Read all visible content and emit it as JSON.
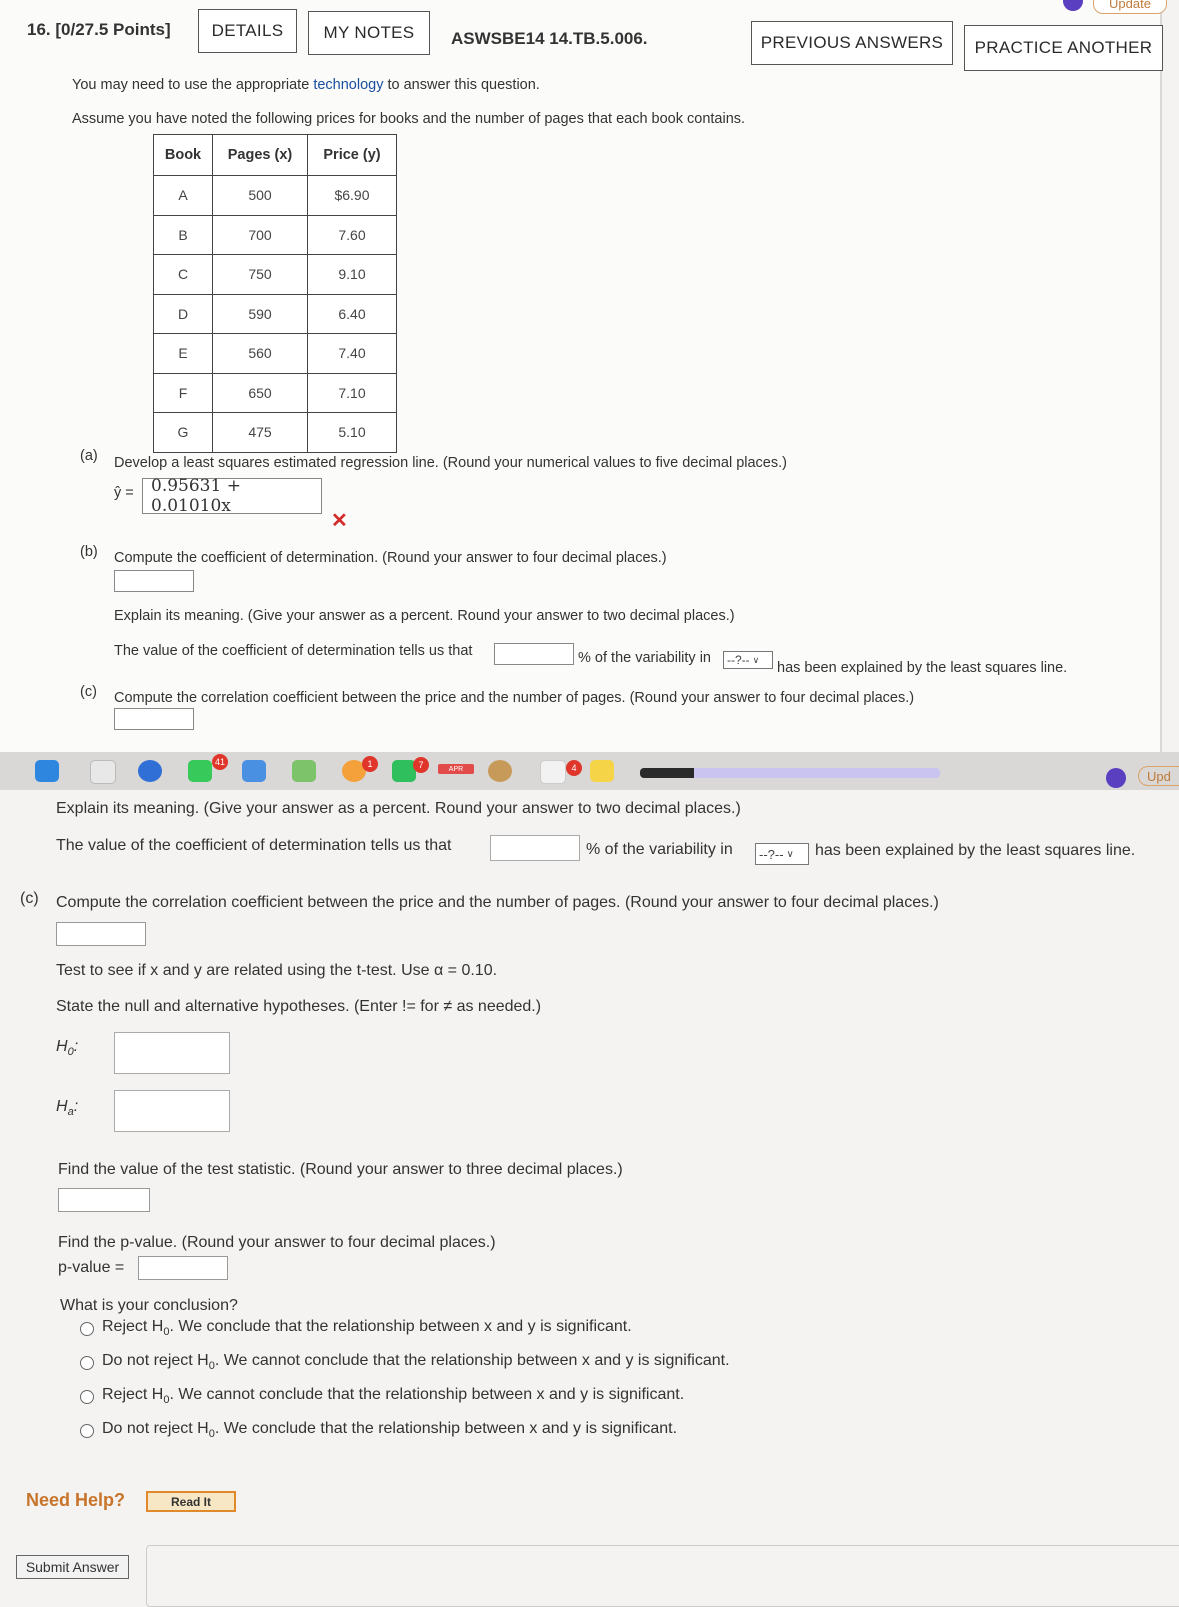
{
  "header": {
    "question_number": "16. [0/27.5 Points]",
    "details_label": "DETAILS",
    "my_notes_label": "MY NOTES",
    "question_code": "ASWSBE14 14.TB.5.006.",
    "previous_answers_label": "PREVIOUS ANSWERS",
    "practice_another_label": "PRACTICE ANOTHER",
    "update_label": "Update"
  },
  "intro": {
    "line1_prefix": "You may need to use the appropriate ",
    "line1_link": "technology",
    "line1_suffix": " to answer this question.",
    "line2": "Assume you have noted the following prices for books and the number of pages that each book contains."
  },
  "table": {
    "headers": [
      "Book",
      "Pages (x)",
      "Price (y)"
    ],
    "rows": [
      [
        "A",
        "500",
        "$6.90"
      ],
      [
        "B",
        "700",
        "7.60"
      ],
      [
        "C",
        "750",
        "9.10"
      ],
      [
        "D",
        "590",
        "6.40"
      ],
      [
        "E",
        "560",
        "7.40"
      ],
      [
        "F",
        "650",
        "7.10"
      ],
      [
        "G",
        "475",
        "5.10"
      ]
    ]
  },
  "part_a": {
    "label": "(a)",
    "prompt": "Develop a least squares estimated regression line. (Round your numerical values to five decimal places.)",
    "yhat_label": "ŷ =",
    "answer_value": "0.95631 + 0.01010x",
    "incorrect_mark": "✕"
  },
  "part_b": {
    "label": "(b)",
    "prompt": "Compute the coefficient of determination. (Round your answer to four decimal places.)",
    "explain": "Explain its meaning. (Give your answer as a percent. Round your answer to two decimal places.)",
    "sentence_prefix": "The value of the coefficient of determination tells us that",
    "sentence_mid": "% of the variability in",
    "select_value": "--?--",
    "sentence_suffix": "has been explained by the least squares line."
  },
  "part_c": {
    "label": "(c)",
    "prompt": "Compute the correlation coefficient between the price and the number of pages. (Round your answer to four decimal places.)"
  },
  "lower": {
    "explain": "Explain its meaning. (Give your answer as a percent. Round your answer to two decimal places.)",
    "sentence_prefix": "The value of the coefficient of determination tells us that",
    "sentence_mid": "% of the variability in",
    "select_value": "--?--",
    "sentence_suffix": "has been explained by the least squares line.",
    "c_label": "(c)",
    "c_prompt": "Compute the correlation coefficient between the price and the number of pages. (Round your answer to four decimal places.)",
    "test_prompt": "Test to see if x and y are related using the t-test. Use α = 0.10.",
    "hyp_prompt": "State the null and alternative hypotheses. (Enter != for ≠ as needed.)",
    "h0_label": "H",
    "h0_sub": "0",
    "ha_label": "H",
    "ha_sub": "a",
    "stat_prompt": "Find the value of the test statistic. (Round your answer to three decimal places.)",
    "pval_prompt": "Find the p-value. (Round your answer to four decimal places.)",
    "pval_label": "p-value =",
    "conclusion_prompt": "What is your conclusion?",
    "options": [
      {
        "pre": "Reject H",
        "sub": "0",
        "post": ". We conclude that the relationship between x and y is significant."
      },
      {
        "pre": "Do not reject H",
        "sub": "0",
        "post": ". We cannot conclude that the relationship between x and y is significant."
      },
      {
        "pre": "Reject H",
        "sub": "0",
        "post": ". We cannot conclude that the relationship between x and y is significant."
      },
      {
        "pre": "Do not reject H",
        "sub": "0",
        "post": ". We conclude that the relationship between x and y is significant."
      }
    ],
    "need_help": "Need Help?",
    "read_it": "Read It",
    "submit": "Submit Answer"
  },
  "taskbar": {
    "badges": [
      "41",
      "1",
      "7",
      "4"
    ],
    "calendar_label": "APR",
    "right_label": "Upd"
  }
}
